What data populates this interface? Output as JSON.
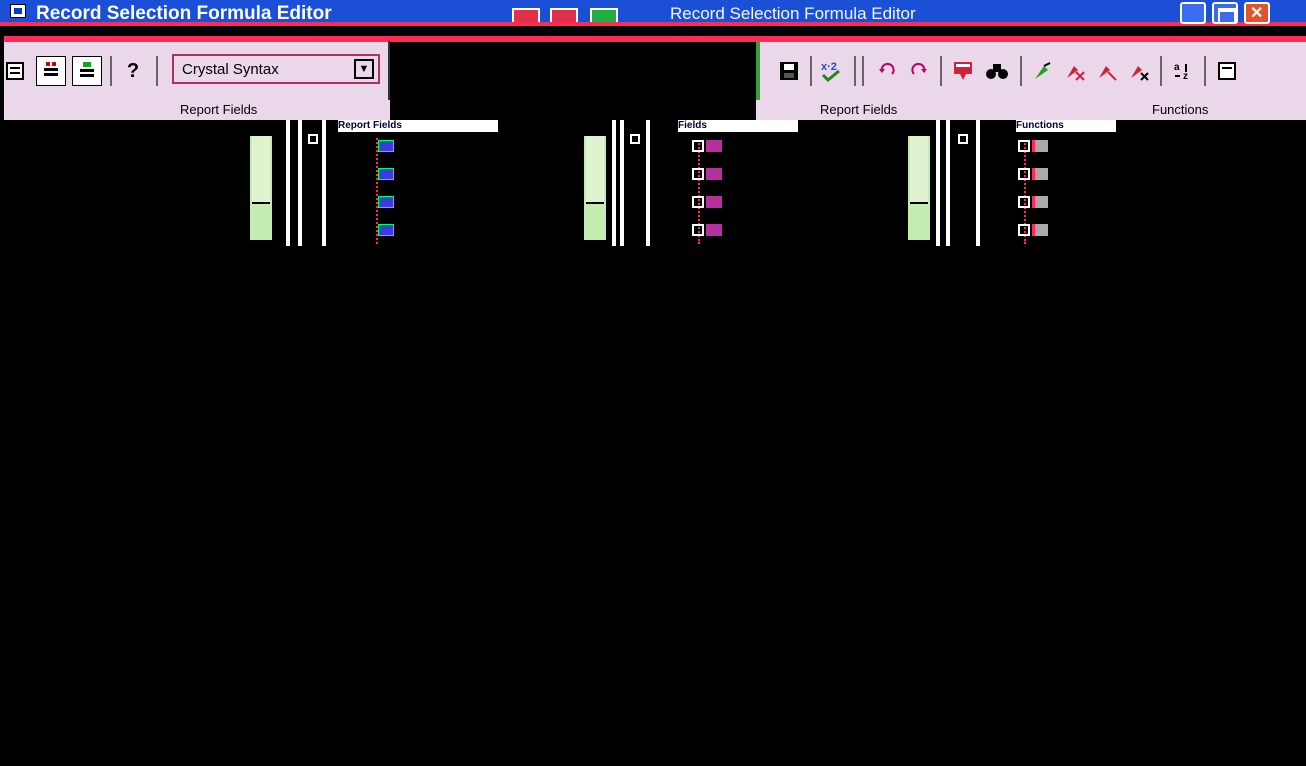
{
  "window": {
    "title": "Record Selection Formula Editor",
    "title_ghost": "Record Selection Formula Editor"
  },
  "toolbar": {
    "help_label": "?",
    "syntax_value": "Crystal Syntax"
  },
  "subbars": {
    "left_label": "Report Fields",
    "right_label": "Functions"
  },
  "panes": [
    {
      "header": "Report Fields",
      "nodes": [
        "",
        "",
        "",
        ""
      ],
      "icon": "database-field-icon"
    },
    {
      "header": "Fields",
      "nodes": [
        "",
        "",
        "",
        ""
      ],
      "icon": "field-icon"
    },
    {
      "header": "Functions",
      "nodes": [
        "",
        "",
        "",
        ""
      ],
      "icon": "function-icon"
    }
  ],
  "icons": {
    "save": "save-icon",
    "check": "check-formula-icon",
    "undo": "undo-icon",
    "redo": "redo-icon",
    "browse": "browse-data-icon",
    "find": "find-icon",
    "bookmark": "bookmark-icon",
    "sort": "sort-icon"
  },
  "colors": {
    "titlebar": "#1a4fd6",
    "accent_red": "#ff2a55",
    "toolbar_bg": "#ead8ea",
    "scroll_green": "#c4ecb0"
  }
}
